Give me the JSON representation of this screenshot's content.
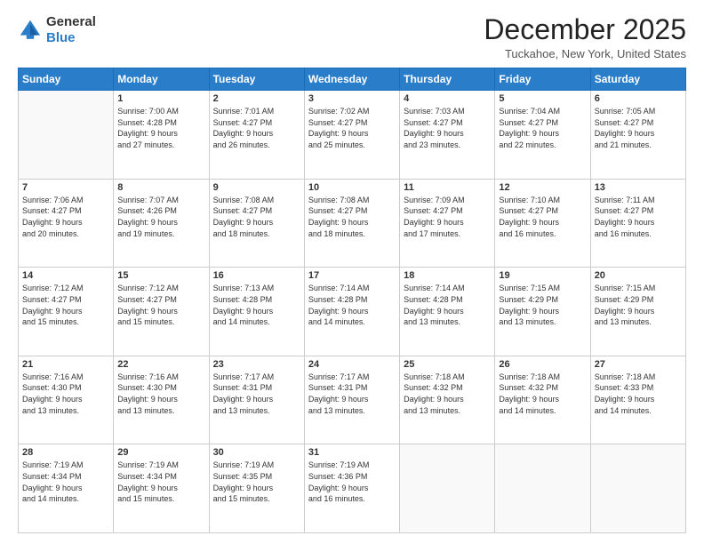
{
  "logo": {
    "line1": "General",
    "line2": "Blue"
  },
  "title": "December 2025",
  "subtitle": "Tuckahoe, New York, United States",
  "weekdays": [
    "Sunday",
    "Monday",
    "Tuesday",
    "Wednesday",
    "Thursday",
    "Friday",
    "Saturday"
  ],
  "weeks": [
    [
      {
        "day": "",
        "info": ""
      },
      {
        "day": "1",
        "info": "Sunrise: 7:00 AM\nSunset: 4:28 PM\nDaylight: 9 hours\nand 27 minutes."
      },
      {
        "day": "2",
        "info": "Sunrise: 7:01 AM\nSunset: 4:27 PM\nDaylight: 9 hours\nand 26 minutes."
      },
      {
        "day": "3",
        "info": "Sunrise: 7:02 AM\nSunset: 4:27 PM\nDaylight: 9 hours\nand 25 minutes."
      },
      {
        "day": "4",
        "info": "Sunrise: 7:03 AM\nSunset: 4:27 PM\nDaylight: 9 hours\nand 23 minutes."
      },
      {
        "day": "5",
        "info": "Sunrise: 7:04 AM\nSunset: 4:27 PM\nDaylight: 9 hours\nand 22 minutes."
      },
      {
        "day": "6",
        "info": "Sunrise: 7:05 AM\nSunset: 4:27 PM\nDaylight: 9 hours\nand 21 minutes."
      }
    ],
    [
      {
        "day": "7",
        "info": "Sunrise: 7:06 AM\nSunset: 4:27 PM\nDaylight: 9 hours\nand 20 minutes."
      },
      {
        "day": "8",
        "info": "Sunrise: 7:07 AM\nSunset: 4:26 PM\nDaylight: 9 hours\nand 19 minutes."
      },
      {
        "day": "9",
        "info": "Sunrise: 7:08 AM\nSunset: 4:27 PM\nDaylight: 9 hours\nand 18 minutes."
      },
      {
        "day": "10",
        "info": "Sunrise: 7:08 AM\nSunset: 4:27 PM\nDaylight: 9 hours\nand 18 minutes."
      },
      {
        "day": "11",
        "info": "Sunrise: 7:09 AM\nSunset: 4:27 PM\nDaylight: 9 hours\nand 17 minutes."
      },
      {
        "day": "12",
        "info": "Sunrise: 7:10 AM\nSunset: 4:27 PM\nDaylight: 9 hours\nand 16 minutes."
      },
      {
        "day": "13",
        "info": "Sunrise: 7:11 AM\nSunset: 4:27 PM\nDaylight: 9 hours\nand 16 minutes."
      }
    ],
    [
      {
        "day": "14",
        "info": "Sunrise: 7:12 AM\nSunset: 4:27 PM\nDaylight: 9 hours\nand 15 minutes."
      },
      {
        "day": "15",
        "info": "Sunrise: 7:12 AM\nSunset: 4:27 PM\nDaylight: 9 hours\nand 15 minutes."
      },
      {
        "day": "16",
        "info": "Sunrise: 7:13 AM\nSunset: 4:28 PM\nDaylight: 9 hours\nand 14 minutes."
      },
      {
        "day": "17",
        "info": "Sunrise: 7:14 AM\nSunset: 4:28 PM\nDaylight: 9 hours\nand 14 minutes."
      },
      {
        "day": "18",
        "info": "Sunrise: 7:14 AM\nSunset: 4:28 PM\nDaylight: 9 hours\nand 13 minutes."
      },
      {
        "day": "19",
        "info": "Sunrise: 7:15 AM\nSunset: 4:29 PM\nDaylight: 9 hours\nand 13 minutes."
      },
      {
        "day": "20",
        "info": "Sunrise: 7:15 AM\nSunset: 4:29 PM\nDaylight: 9 hours\nand 13 minutes."
      }
    ],
    [
      {
        "day": "21",
        "info": "Sunrise: 7:16 AM\nSunset: 4:30 PM\nDaylight: 9 hours\nand 13 minutes."
      },
      {
        "day": "22",
        "info": "Sunrise: 7:16 AM\nSunset: 4:30 PM\nDaylight: 9 hours\nand 13 minutes."
      },
      {
        "day": "23",
        "info": "Sunrise: 7:17 AM\nSunset: 4:31 PM\nDaylight: 9 hours\nand 13 minutes."
      },
      {
        "day": "24",
        "info": "Sunrise: 7:17 AM\nSunset: 4:31 PM\nDaylight: 9 hours\nand 13 minutes."
      },
      {
        "day": "25",
        "info": "Sunrise: 7:18 AM\nSunset: 4:32 PM\nDaylight: 9 hours\nand 13 minutes."
      },
      {
        "day": "26",
        "info": "Sunrise: 7:18 AM\nSunset: 4:32 PM\nDaylight: 9 hours\nand 14 minutes."
      },
      {
        "day": "27",
        "info": "Sunrise: 7:18 AM\nSunset: 4:33 PM\nDaylight: 9 hours\nand 14 minutes."
      }
    ],
    [
      {
        "day": "28",
        "info": "Sunrise: 7:19 AM\nSunset: 4:34 PM\nDaylight: 9 hours\nand 14 minutes."
      },
      {
        "day": "29",
        "info": "Sunrise: 7:19 AM\nSunset: 4:34 PM\nDaylight: 9 hours\nand 15 minutes."
      },
      {
        "day": "30",
        "info": "Sunrise: 7:19 AM\nSunset: 4:35 PM\nDaylight: 9 hours\nand 15 minutes."
      },
      {
        "day": "31",
        "info": "Sunrise: 7:19 AM\nSunset: 4:36 PM\nDaylight: 9 hours\nand 16 minutes."
      },
      {
        "day": "",
        "info": ""
      },
      {
        "day": "",
        "info": ""
      },
      {
        "day": "",
        "info": ""
      }
    ]
  ]
}
